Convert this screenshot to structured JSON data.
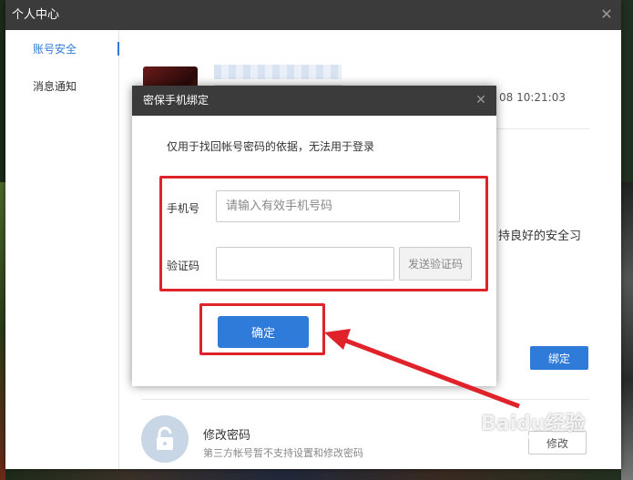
{
  "window": {
    "title": "个人中心",
    "close_icon": "close-icon"
  },
  "sidebar": {
    "items": [
      {
        "label": "账号安全",
        "active": true
      },
      {
        "label": "消息通知",
        "active": false
      }
    ]
  },
  "account": {
    "login_time": "08 10:21:03",
    "security_tip": "持良好的安全习",
    "bind_label": "绑定"
  },
  "password": {
    "title": "修改密码",
    "description": "第三方帐号暂不支持设置和修改密码",
    "edit_label": "修改"
  },
  "modal": {
    "title": "密保手机绑定",
    "note": "仅用于找回帐号密码的依据，无法用于登录",
    "phone_label": "手机号",
    "phone_placeholder": "请输入有效手机号码",
    "code_label": "验证码",
    "send_code_label": "发送验证码",
    "confirm_label": "确定"
  },
  "watermark": {
    "brand": "Baidu经验",
    "url": "jingyan.baidu.com"
  },
  "colors": {
    "accent": "#2f7bd9",
    "annotation": "#e0232a",
    "titlebar": "#3b3b3b"
  }
}
